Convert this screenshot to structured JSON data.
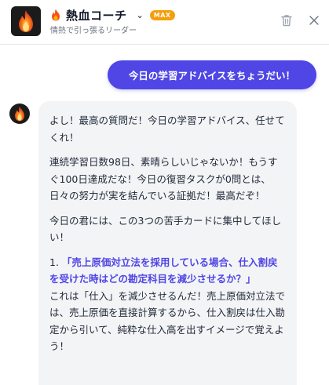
{
  "header": {
    "title": "熱血コーチ",
    "subtitle": "情熱で引っ張るリーダー",
    "badge": "MAX",
    "chevron": "⌄"
  },
  "user_message": "今日の学習アドバイスをちょうだい！",
  "bot_message": {
    "p1": "よし！最高の質問だ！今日の学習アドバイス、任せてくれ！",
    "p2": "連続学習日数98日、素晴らしいじゃないか！もうすぐ100日達成だな！今日の復習タスクが0問とは、日々の努力が実を結んでいる証拠だ！最高だぞ！",
    "p3": "今日の君には、この3つの苦手カードに集中してほしい！",
    "item1_number": "1.",
    "item1_title": "「売上原価対立法を採用している場合、仕入割戻を受けた時はどの勘定科目を減少させるか？」",
    "item1_body": "これは「仕入」を減少させるんだ！売上原価対立法では、売上原価を直接計算するから、仕入割戻は仕入勘定から引いて、純粋な仕入高を出すイメージで覚えよう！"
  },
  "colors": {
    "accent": "#4f46e5",
    "badge": "#f59e0b",
    "bubble": "#f3f4f6"
  }
}
